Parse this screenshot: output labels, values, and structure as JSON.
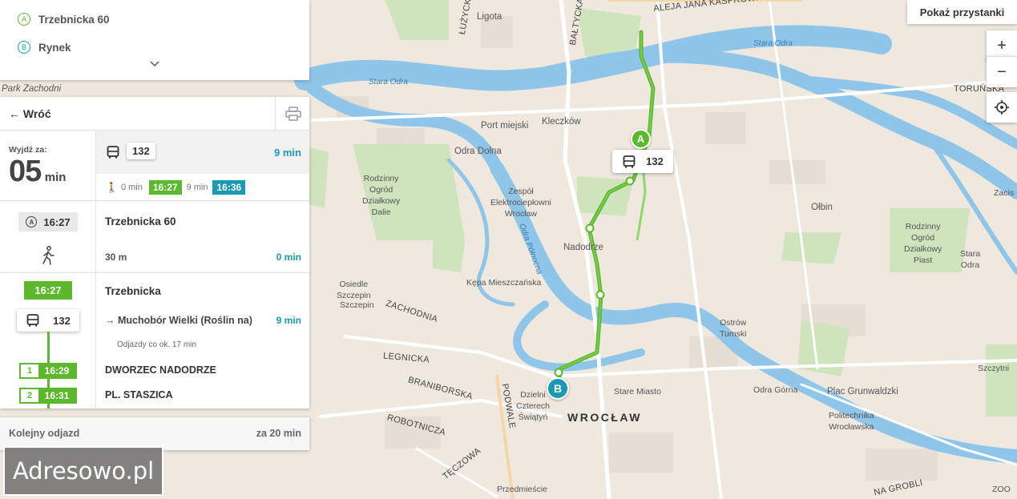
{
  "route_inputs": {
    "from": {
      "marker": "A",
      "name": "Trzebnicka 60"
    },
    "to": {
      "marker": "B",
      "name": "Rynek"
    }
  },
  "top_right": {
    "show_stops_button": "Pokaż przystanki"
  },
  "zoom": {
    "in": "+",
    "out": "−"
  },
  "panel": {
    "back_label": "← Wróć",
    "leave_in_label": "Wyjdź za:",
    "leave_in_value": "05",
    "leave_in_unit": "min",
    "summary_line": "132",
    "summary_duration": "9 min",
    "walk_min": "0 min",
    "depart_time": "16:27",
    "ride_min": "9 min",
    "arrive_time": "16:36",
    "walk_step": {
      "badge": "A",
      "time": "16:27",
      "stop": "Trzebnicka 60",
      "distance": "30 m",
      "duration": "0 min"
    },
    "ride_step": {
      "time": "16:27",
      "line": "132",
      "stop": "Trzebnicka",
      "direction": "→ Muchobór Wielki (Roślin na)",
      "frequency": "Odjazdy co ok. 17 min",
      "duration": "9 min"
    },
    "stops": [
      {
        "num": "1",
        "time": "16:29",
        "name": "DWORZEC NADODRZE"
      },
      {
        "num": "2",
        "time": "16:31",
        "name": "PL. STASZICA"
      }
    ],
    "next_departure_label": "Kolejny odjazd",
    "next_departure_value": "za 20 min"
  },
  "map": {
    "route_line_badge": "132",
    "marker_a": "A",
    "marker_b": "B",
    "labels": {
      "park_zachodni": "Park Zachodni",
      "ligota": "Ligota",
      "lowicka": "ŁUŻYCKA",
      "baltycka": "BAŁTYCKA",
      "kasprowicza": "ALEJA JANA KASPROWICZA",
      "torunska": "TORUŃSKA",
      "stara_odra_1": "Stara Odra",
      "stara_odra_2": "Stara Odra",
      "port_miejski": "Port miejski",
      "kleczkow": "Kleczków",
      "odra_dolna": "Odra Dolna",
      "rodzinny_ogrod_1": "Rodzinny\nOgród\nDziałkowy\nDalie",
      "zespol": "Zespół\nElektrociepłowni\nWrocław",
      "nadodrze": "Nadodrze",
      "olbin": "Ołbin",
      "rodzinny_ogrod_2": "Rodzinny\nOgród\nDziałkowy\nPiast",
      "stara_odra_3": "Stara\nOdra",
      "zacisze": "Zacis",
      "osiedle_szczepin": "Osiedle\nSzczepin",
      "szczepin": "Szczepin",
      "kepa": "Kępa Mieszczańska",
      "zachodnia": "ZACHODNIA",
      "odra_plynna": "Odra Północna",
      "ostrow": "Ostrów\nTumski",
      "legnicka": "LEGNICKA",
      "braniborska": "BRANIBORSKA",
      "podwale": "PODWALE",
      "dzielnica": "Dzielni\nCzterech\nŚwiątyń",
      "stare_miasto": "Stare Miasto",
      "wroclaw": "WROCŁAW",
      "odra_gorna": "Odra Górna",
      "plac_grunwaldzki": "Plac Grunwaldzki",
      "politechnika": "Politechnika\nWrocławska",
      "szczytnicka": "Szczytni",
      "robotnicza": "ROBOTNICZA",
      "teczowa": "TĘCZOWA",
      "przedmiescie": "Przedmieście",
      "na_grobli": "NA GROBLI",
      "zoo": "ZOO"
    }
  },
  "watermark": "Adresowo.pl",
  "colors": {
    "route_green": "#5cb82c",
    "teal": "#1a9ab2",
    "river": "#8ec5e8",
    "park": "#c8e0b4"
  }
}
